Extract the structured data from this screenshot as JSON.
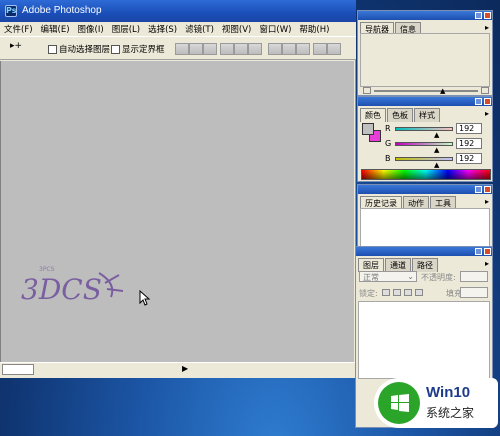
{
  "window": {
    "title": "Adobe Photoshop",
    "app_icon_glyph": "Ps"
  },
  "menu": [
    "文件(F)",
    "编辑(E)",
    "图像(I)",
    "图层(L)",
    "选择(S)",
    "滤镜(T)",
    "视图(V)",
    "窗口(W)",
    "帮助(H)"
  ],
  "options_bar": {
    "tool_glyph": "▸+",
    "auto_select_layer": "自动选择图层",
    "show_bounds": "显示定界框"
  },
  "canvas": {
    "watermark_text": "3DCS",
    "watermark_small": "3PCS"
  },
  "status_bar": {
    "arrow": "▶"
  },
  "navigator_panel": {
    "tabs": [
      "导航器",
      "信息"
    ]
  },
  "color_panel": {
    "tabs": [
      "颜色",
      "色板",
      "样式"
    ],
    "channels": [
      {
        "label": "R",
        "value": "192"
      },
      {
        "label": "G",
        "value": "192"
      },
      {
        "label": "B",
        "value": "192"
      }
    ],
    "foreground_color": "#c0c0c0",
    "background_color": "#e83ed8"
  },
  "history_panel": {
    "tabs": [
      "历史记录",
      "动作",
      "工具"
    ]
  },
  "layers_panel": {
    "tabs": [
      "图层",
      "通道",
      "路径"
    ],
    "blend_mode": "正常",
    "opacity_label": "不透明度:",
    "lock_label": "锁定:",
    "fill_label": "填充:"
  },
  "brand": {
    "name": "Win10",
    "subtitle": "系统之家",
    "accent": "#2aa52a"
  }
}
